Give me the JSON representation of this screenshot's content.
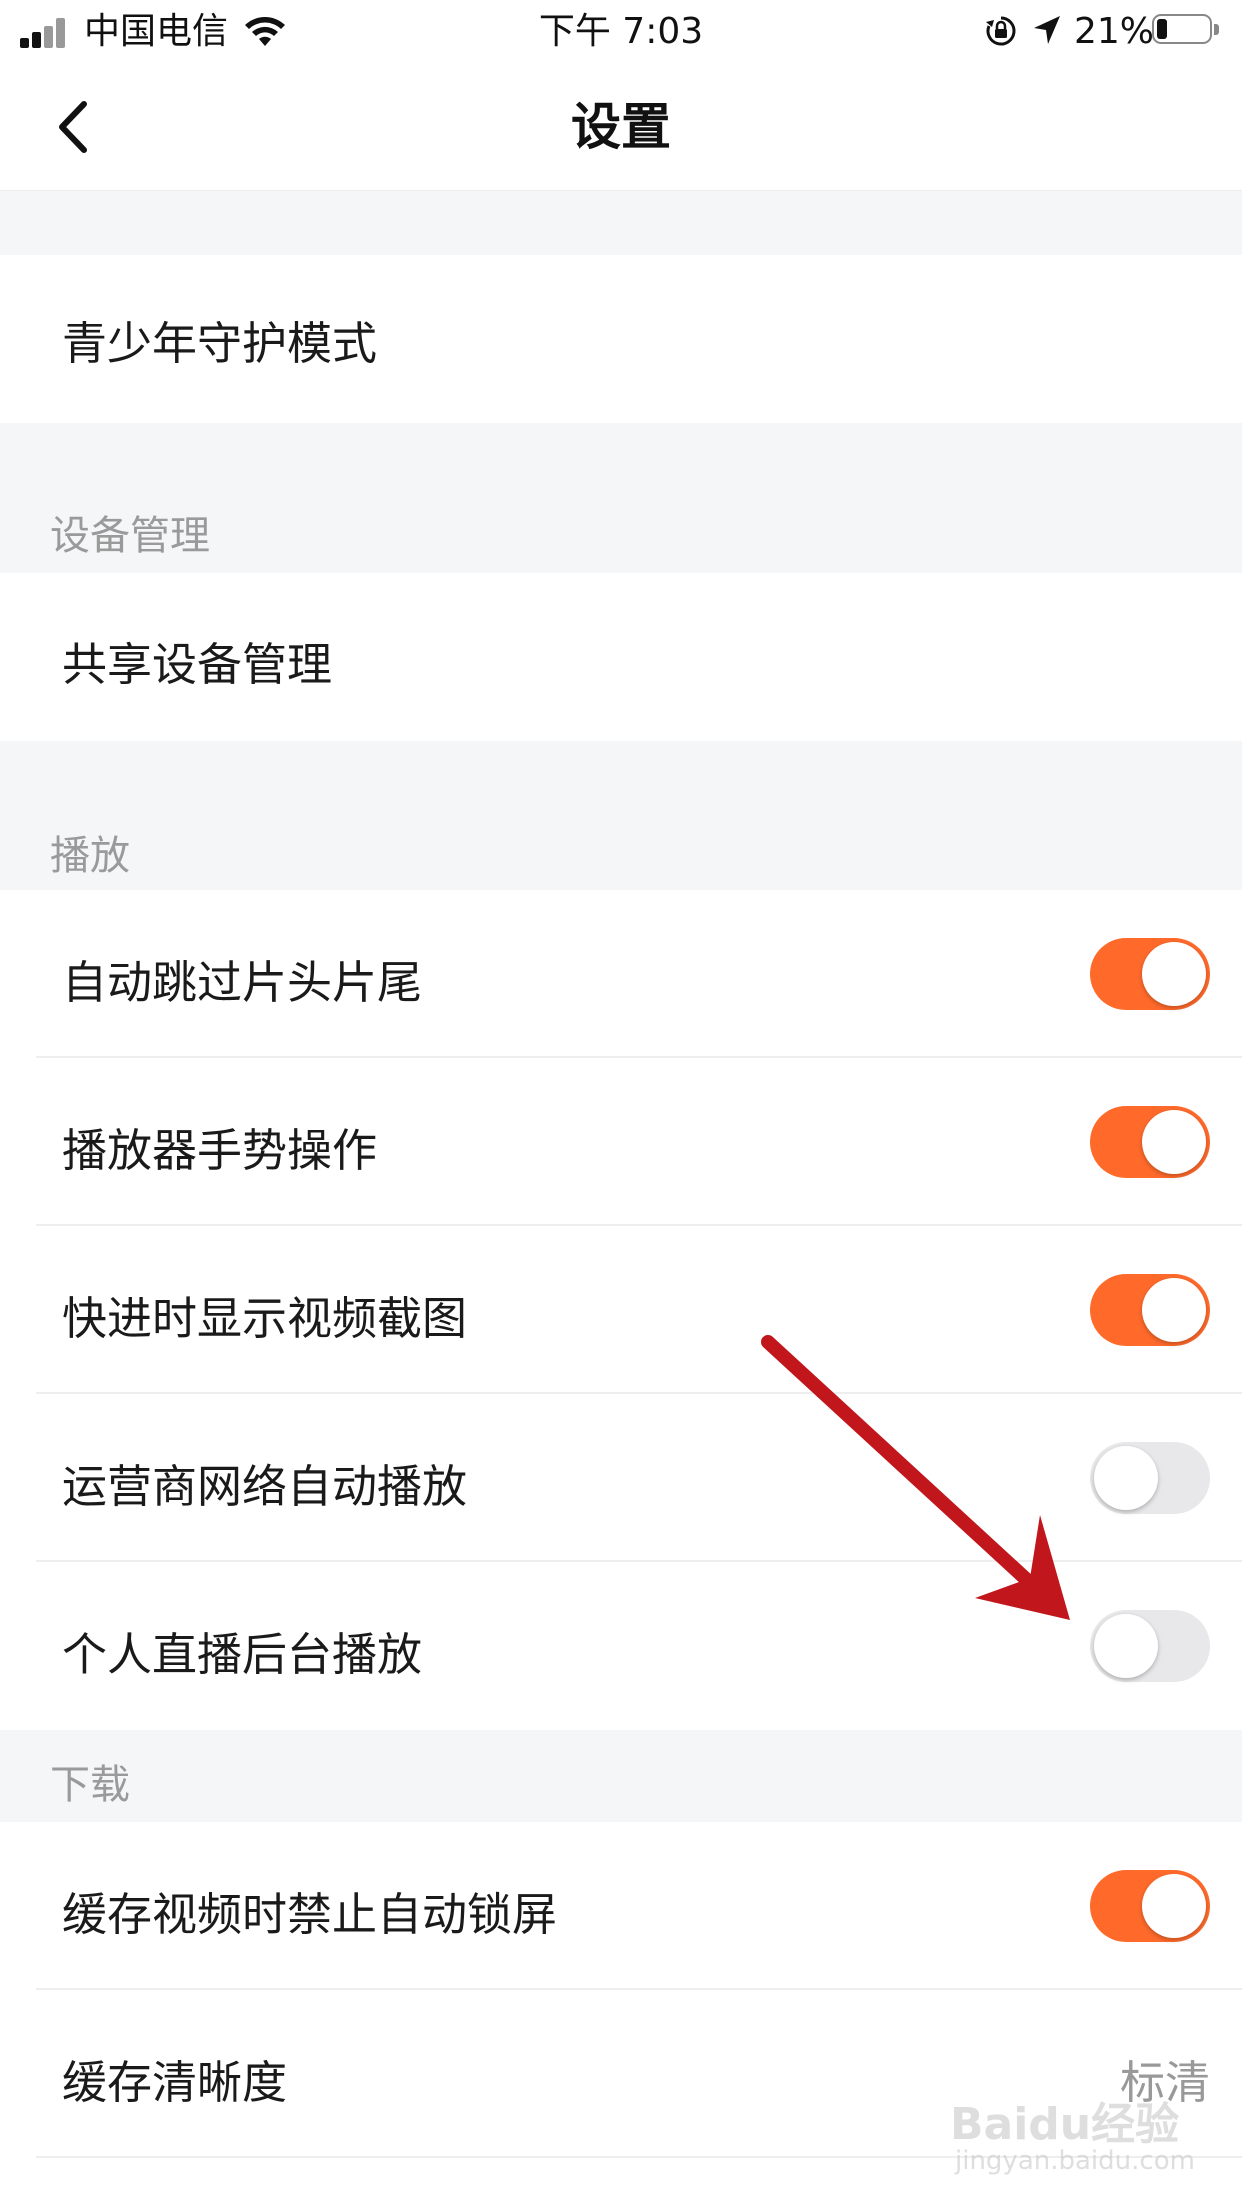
{
  "status_bar": {
    "carrier": "中国电信",
    "time": "下午 7:03",
    "battery": "21%"
  },
  "nav": {
    "title": "设置"
  },
  "sections": {
    "youth": {
      "items": [
        {
          "label": "青少年守护模式"
        }
      ]
    },
    "devices": {
      "header": "设备管理",
      "items": [
        {
          "label": "共享设备管理"
        }
      ]
    },
    "playback": {
      "header": "播放",
      "items": [
        {
          "label": "自动跳过片头片尾",
          "toggle": true
        },
        {
          "label": "播放器手势操作",
          "toggle": true
        },
        {
          "label": "快进时显示视频截图",
          "toggle": true
        },
        {
          "label": "运营商网络自动播放",
          "toggle": false
        },
        {
          "label": "个人直播后台播放",
          "toggle": false
        }
      ]
    },
    "download": {
      "header": "下载",
      "items": [
        {
          "label": "缓存视频时禁止自动锁屏",
          "toggle": true
        },
        {
          "label": "缓存清晰度",
          "value": "标清"
        }
      ]
    }
  },
  "colors": {
    "accent": "#ff6a2b",
    "toggle_off": "#e8e8ea",
    "section_bg": "#f5f6f8",
    "annotation_arrow": "#c0161c"
  },
  "watermark": {
    "brand": "Baidu经验",
    "url": "jingyan.baidu.com"
  }
}
